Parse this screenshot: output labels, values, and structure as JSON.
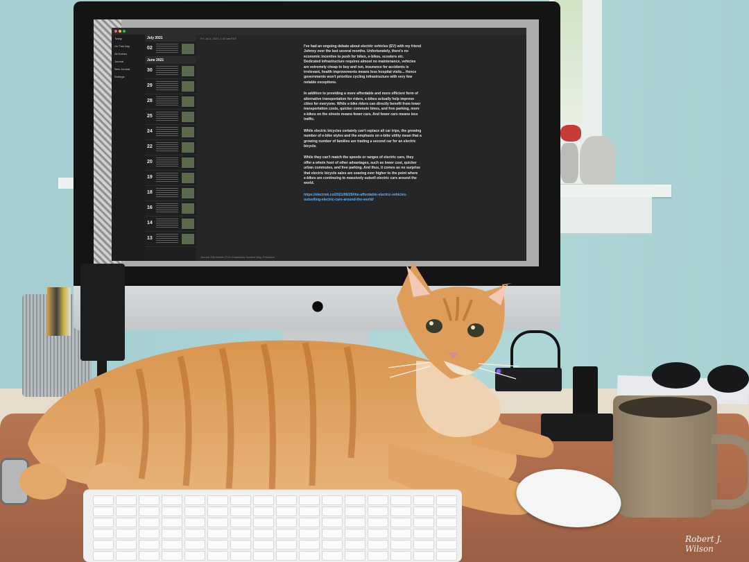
{
  "photo": {
    "subject": "orange tabby cat lying on desk in front of iMac",
    "signature": "Robert J. Wilson"
  },
  "screen": {
    "sidebar": {
      "items": [
        "Today",
        "On This Day",
        "All Entries",
        "Journal",
        "New Journal",
        "Settings"
      ]
    },
    "list": {
      "months": [
        {
          "label": "July 2021",
          "days": [
            {
              "dow": "Fri",
              "day": "02"
            }
          ]
        },
        {
          "label": "June 2021",
          "days": [
            {
              "dow": "Wed",
              "day": "30"
            },
            {
              "dow": "Tue",
              "day": "29"
            },
            {
              "dow": "Mon",
              "day": "28"
            },
            {
              "dow": "Fri",
              "day": "25"
            },
            {
              "dow": "Thu",
              "day": "24"
            },
            {
              "dow": "Tue",
              "day": "22"
            },
            {
              "dow": "Sun",
              "day": "20"
            },
            {
              "dow": "Sat",
              "day": "19"
            },
            {
              "dow": "Fri",
              "day": "18"
            },
            {
              "dow": "Wed",
              "day": "16"
            },
            {
              "dow": "Tue",
              "day": "14"
            },
            {
              "dow": "Sun",
              "day": "13"
            }
          ]
        }
      ]
    },
    "editor": {
      "header": "Fri, Jul 2, 2021, 1:10 am EDT",
      "paragraphs": [
        "I've had an ongoing debate about electric vehicles (EV) with my friend Johnny over the last several months. Unfortunately, there's no economic incentive to push for bikes, e-bikes, scooters etc. Dedicated infrastructure requires almost no maintenance, vehicles are extremely cheap to buy and run, insurance for accidents is irrelevant, health improvements means less hospital visits... Hence governments won't prioritize cycling infrastructure with very few notable exceptions.",
        "In addition to providing a more affordable and more efficient form of alternative transportation for riders, e-bikes actually help improve cities for everyone. While e-bike riders can directly benefit from lower transportation costs, quicker commute times, and free parking, more e-bikes on the streets means fewer cars. And fewer cars means less traffic.",
        "While electric bicycles certainly can't replace all car trips, the growing number of e-bike styles and the emphasis on e-bike utility mean that a growing number of families are trading a second car for an electric bicycle.",
        "While they can't match the speeds or ranges of electric cars, they offer a whole host of other advantages, such as lower cost, quicker urban commutes, and free parking. And thus, it comes as no surprise that electric bicycle sales are soaring ever higher to the point where e-bikes are continuing to massively outsell electric cars around the world."
      ],
      "link": "https://electrek.co/2021/06/29/the-affordable-electric-vehicles-outselling-electric-cars-around-the-world/",
      "footer": "Journal   338 Words   2712 Characters   Sunbird Way, Princeton"
    }
  },
  "colors": {
    "wall": "#a9d1d3",
    "cat_fur": "#d9954f",
    "mat": "#a8684a"
  }
}
